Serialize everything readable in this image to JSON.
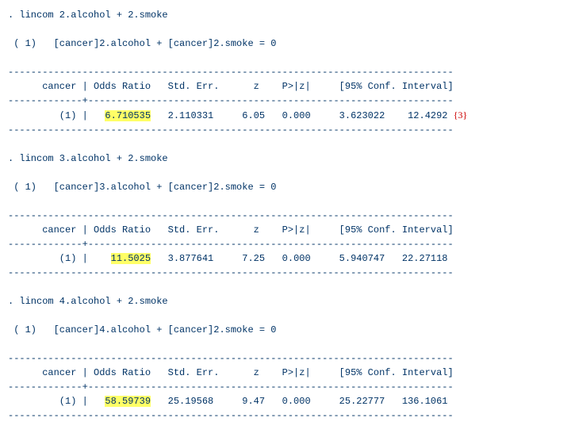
{
  "blocks": [
    {
      "command": ". lincom 2.alcohol + 2.smoke",
      "constraint_prefix": " ( 1)   ",
      "constraint": "[cancer]2.alcohol + [cancer]2.smoke = 0",
      "hr": "------------------------------------------------------------------------------",
      "hdr": "      cancer | Odds Ratio   Std. Err.      z    P>|z|     [95% Conf. Interval]",
      "mid": "-------------+----------------------------------------------------------------",
      "row_prefix": "         (1) |   ",
      "odds_ratio": "6.710535",
      "row_suffix": "   2.110331     6.05   0.000     3.623022    12.4292",
      "annotation": "{3}"
    },
    {
      "command": ". lincom 3.alcohol + 2.smoke",
      "constraint_prefix": " ( 1)   ",
      "constraint": "[cancer]3.alcohol + [cancer]2.smoke = 0",
      "hr": "------------------------------------------------------------------------------",
      "hdr": "      cancer | Odds Ratio   Std. Err.      z    P>|z|     [95% Conf. Interval]",
      "mid": "-------------+----------------------------------------------------------------",
      "row_prefix": "         (1) |    ",
      "odds_ratio": "11.5025",
      "row_suffix": "   3.877641     7.25   0.000     5.940747   22.27118",
      "annotation": ""
    },
    {
      "command": ". lincom 4.alcohol + 2.smoke",
      "constraint_prefix": " ( 1)   ",
      "constraint": "[cancer]4.alcohol + [cancer]2.smoke = 0",
      "hr": "------------------------------------------------------------------------------",
      "hdr": "      cancer | Odds Ratio   Std. Err.      z    P>|z|     [95% Conf. Interval]",
      "mid": "-------------+----------------------------------------------------------------",
      "row_prefix": "         (1) |   ",
      "odds_ratio": "58.59739",
      "row_suffix": "   25.19568     9.47   0.000     25.22777   136.1061",
      "annotation": ""
    }
  ]
}
